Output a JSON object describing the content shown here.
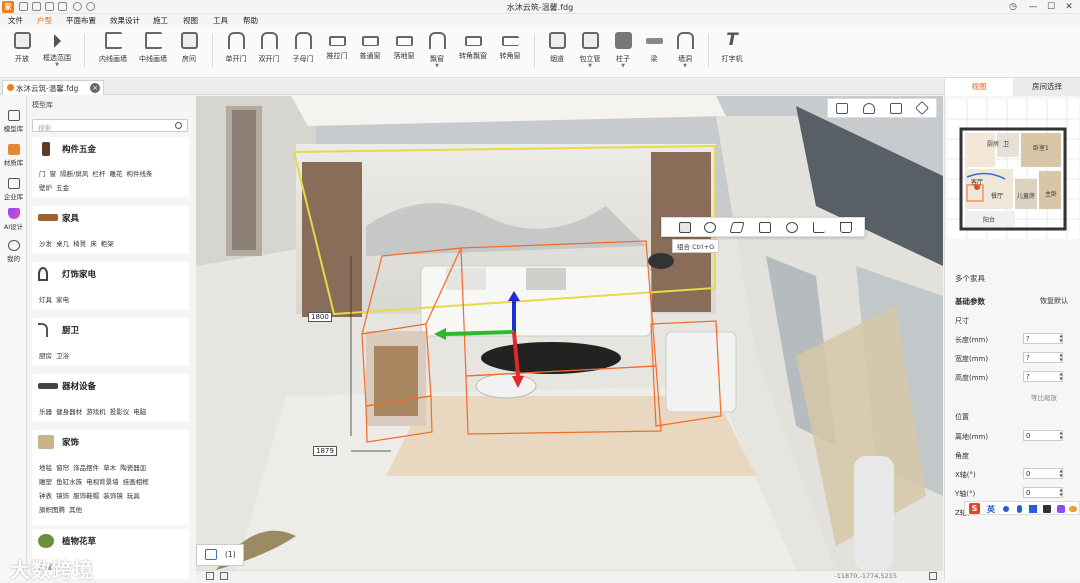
{
  "window": {
    "title": "水沐云筑-温馨.fdg"
  },
  "menu": [
    "文件",
    "户型",
    "平面布置",
    "效果设计",
    "施工",
    "视图",
    "工具",
    "帮助"
  ],
  "ribbon": [
    {
      "label": "开放"
    },
    {
      "label": "框选范围"
    },
    {
      "label": "内线画墙"
    },
    {
      "label": "中线画墙"
    },
    {
      "label": "房间"
    },
    {
      "label": "单开门"
    },
    {
      "label": "双开门"
    },
    {
      "label": "子母门"
    },
    {
      "label": "推拉门"
    },
    {
      "label": "普通窗"
    },
    {
      "label": "落地窗"
    },
    {
      "label": "飘窗"
    },
    {
      "label": "转角飘窗"
    },
    {
      "label": "转角窗"
    },
    {
      "label": "烟道"
    },
    {
      "label": "包立管"
    },
    {
      "label": "柱子"
    },
    {
      "label": "梁"
    },
    {
      "label": "墙洞"
    },
    {
      "label": "打字机"
    }
  ],
  "doc_tab": {
    "label": "水沐云筑-温馨.fdg",
    "close": "×"
  },
  "rail": [
    {
      "label": "模型库"
    },
    {
      "label": "材质库"
    },
    {
      "label": "企业库"
    },
    {
      "label": "AI设计"
    },
    {
      "label": "我的"
    }
  ],
  "library": {
    "title": "模型库",
    "search_placeholder": "搜索",
    "categories": [
      {
        "name": "构件五金",
        "lines": [
          "门 窗 隔断/屏风 栏杆 雕花 构件线条",
          "壁炉 五金"
        ]
      },
      {
        "name": "家具",
        "lines": [
          "沙发 桌几 椅凳 床 柜架"
        ]
      },
      {
        "name": "灯饰家电",
        "lines": [
          "灯具 家电"
        ]
      },
      {
        "name": "厨卫",
        "lines": [
          "厨房 卫浴"
        ]
      },
      {
        "name": "器材设备",
        "lines": [
          "乐器 健身器材 游戏机 投影仪 电脑"
        ]
      },
      {
        "name": "家饰",
        "lines": [
          "地毯 窗帘 饰品摆件 草木 陶瓷器皿",
          "雕塑 鱼缸水族 电视背景墙 挂画相框",
          "钟表 镜饰 服饰鞋帽 装饰镜 玩具",
          "旗帜图腾 其他"
        ]
      },
      {
        "name": "植物花草",
        "lines": [
          "盆栽"
        ]
      }
    ]
  },
  "viewport": {
    "dim_height": "1800",
    "dim_width": "1879",
    "tooltip": "组合 Ctrl+G",
    "page_tab": "(1)",
    "coords": "-11870,-1774,5215"
  },
  "right_panel": {
    "tabs": [
      "视图",
      "房间选择"
    ],
    "minimap_rooms": [
      "厨房",
      "卫",
      "卧室1",
      "客厅",
      "餐厅",
      "主卧",
      "儿童房",
      "阳台"
    ],
    "section": "多个家具",
    "basic": "基础参数",
    "reset": "恢复默认",
    "size": "尺寸",
    "fields": [
      {
        "label": "长度(mm)",
        "value": "?"
      },
      {
        "label": "宽度(mm)",
        "value": "?"
      },
      {
        "label": "高度(mm)",
        "value": "?"
      }
    ],
    "lock": "等比缩放",
    "position": "位置",
    "ground": {
      "label": "离地(mm)",
      "value": "0"
    },
    "angle": "角度",
    "angles": [
      {
        "label": "X轴(°)",
        "value": "0"
      },
      {
        "label": "Y轴(°)",
        "value": "0"
      },
      {
        "label": "Z轴(°)",
        "value": ""
      }
    ]
  },
  "ime": "英",
  "watermark": "大数跨境",
  "colors": {
    "accent": "#e0691b",
    "selection": "#f26a2a",
    "highlight": "#e8d84a"
  }
}
